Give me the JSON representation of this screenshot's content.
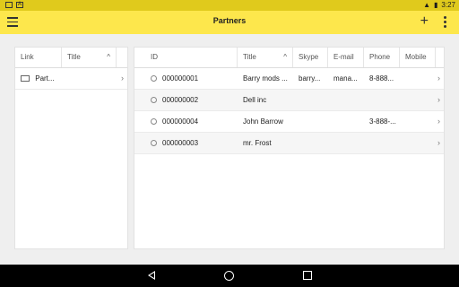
{
  "status": {
    "time": "3:27"
  },
  "appbar": {
    "title": "Partners"
  },
  "left_table": {
    "columns": [
      "Link",
      "Title"
    ],
    "rows": [
      {
        "link": "Part..."
      }
    ]
  },
  "right_table": {
    "columns": [
      "ID",
      "Title",
      "Skype",
      "E-mail",
      "Phone",
      "Mobile"
    ],
    "rows": [
      {
        "id": "000000001",
        "title": "Barry mods ...",
        "skype": "barry...",
        "email": "mana...",
        "phone": "8-888...",
        "mobile": ""
      },
      {
        "id": "000000002",
        "title": "Dell inc",
        "skype": "",
        "email": "",
        "phone": "",
        "mobile": ""
      },
      {
        "id": "000000004",
        "title": "John Barrow",
        "skype": "",
        "email": "",
        "phone": "3-888-...",
        "mobile": ""
      },
      {
        "id": "000000003",
        "title": "mr. Frost",
        "skype": "",
        "email": "",
        "phone": "",
        "mobile": ""
      }
    ]
  },
  "colors": {
    "appbar": "#fde74c",
    "statusbar": "#e0ca1c"
  }
}
